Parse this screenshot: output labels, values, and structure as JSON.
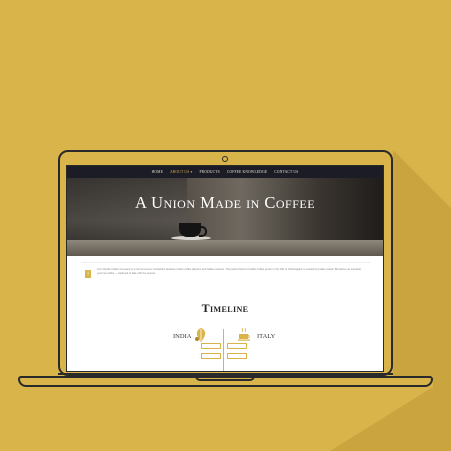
{
  "nav": {
    "items": [
      "Home",
      "About Us ▾",
      "Products",
      "Coffee Knowledge",
      "Contact Us"
    ],
    "active_index": 1
  },
  "hero": {
    "title": "A Union Made in Coffee"
  },
  "intro": {
    "badge": "i",
    "text": "Arun Nestle Coffee Company is a 'lemon-tra-lue' similarities between Indian coffee planters and Italian roasters. The perfect blend of Arabic coffee grown in the hills of Chikmagalur is roasted by Italian master Bruciatore as exquisite gourmet coffee — deduced to lake with the senses."
  },
  "timeline": {
    "title": "Timeline",
    "left_label": "INDIA",
    "right_label": "ITALY",
    "boxes": [
      "",
      "",
      "",
      ""
    ]
  },
  "colors": {
    "background": "#d8b44b",
    "accent": "#d8b44b",
    "nav_bg": "#1c1c26"
  },
  "icons": {
    "left": "coffee-leaf-icon",
    "right": "coffee-cup-icon"
  }
}
